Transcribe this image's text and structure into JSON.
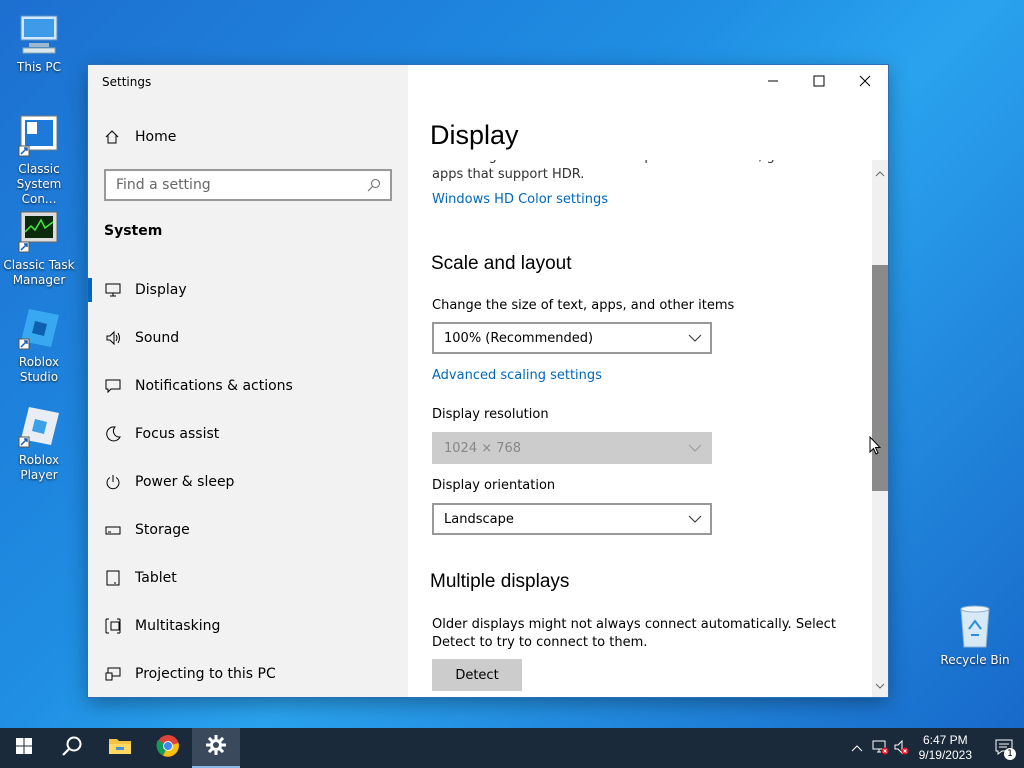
{
  "desktop": {
    "icons": [
      {
        "label": "This PC",
        "icon": "computer-icon"
      },
      {
        "label": "Classic System Con...",
        "icon": "control-panel-icon"
      },
      {
        "label": "Classic Task Manager",
        "icon": "task-manager-icon"
      },
      {
        "label": "Roblox Studio",
        "icon": "roblox-studio-icon"
      },
      {
        "label": "Roblox Player",
        "icon": "roblox-player-icon"
      },
      {
        "label": "Recycle Bin",
        "icon": "recycle-bin-icon"
      }
    ]
  },
  "window": {
    "title": "Settings",
    "sidebar": {
      "home_label": "Home",
      "search_placeholder": "Find a setting",
      "section": "System",
      "items": [
        {
          "label": "Display",
          "icon": "monitor-icon"
        },
        {
          "label": "Sound",
          "icon": "speaker-icon"
        },
        {
          "label": "Notifications & actions",
          "icon": "notification-icon"
        },
        {
          "label": "Focus assist",
          "icon": "moon-icon"
        },
        {
          "label": "Power & sleep",
          "icon": "power-icon"
        },
        {
          "label": "Storage",
          "icon": "storage-icon"
        },
        {
          "label": "Tablet",
          "icon": "tablet-icon"
        },
        {
          "label": "Multitasking",
          "icon": "multitasking-icon"
        },
        {
          "label": "Projecting to this PC",
          "icon": "projecting-icon"
        }
      ]
    },
    "content": {
      "title": "Display",
      "hdr_text": "Get a brighter and more vibrant picture for videos, games and apps that support HDR.",
      "hdr_link": "Windows HD Color settings",
      "scale_heading": "Scale and layout",
      "scale_label": "Change the size of text, apps, and other items",
      "scale_value": "100% (Recommended)",
      "advanced_link": "Advanced scaling settings",
      "resolution_label": "Display resolution",
      "resolution_value": "1024 × 768",
      "orientation_label": "Display orientation",
      "orientation_value": "Landscape",
      "multi_heading": "Multiple displays",
      "multi_text": "Older displays might not always connect automatically. Select Detect to try to connect to them.",
      "detect_label": "Detect"
    }
  },
  "taskbar": {
    "time": "6:47 PM",
    "date": "9/19/2023",
    "notification_count": "1"
  },
  "colors": {
    "accent": "#0067b8",
    "taskbar": "#1b2a3a"
  }
}
